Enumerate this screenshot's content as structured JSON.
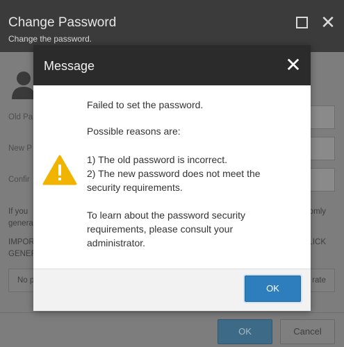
{
  "change_password": {
    "title": "Change Password",
    "subtitle": "Change the password.",
    "labels": {
      "old": "Old Pa",
      "new": "New P",
      "confirm": "Confir"
    },
    "info_left_1": "If you",
    "info_left_2": "genera",
    "info_right_1": "omly",
    "important_left_1": "IMPOR",
    "important_left_2": "GENER",
    "important_right_1": "LICK",
    "field_left": "No p",
    "field_right": "rate",
    "ok_label": "OK",
    "cancel_label": "Cancel"
  },
  "message": {
    "title": "Message",
    "line1": "Failed to set the password.",
    "line2": "Possible reasons are:",
    "line3": "1) The old password is incorrect.",
    "line4": "2) The new password does not meet the",
    "line5": "security requirements.",
    "line6": "To learn about the password security",
    "line7": "requirements, please consult your",
    "line8": "administrator.",
    "ok_label": "OK",
    "icon": "warning-icon"
  },
  "colors": {
    "header_dark": "#2b2b2b",
    "primary_button": "#2e7ebd",
    "warning": "#f0b400"
  }
}
